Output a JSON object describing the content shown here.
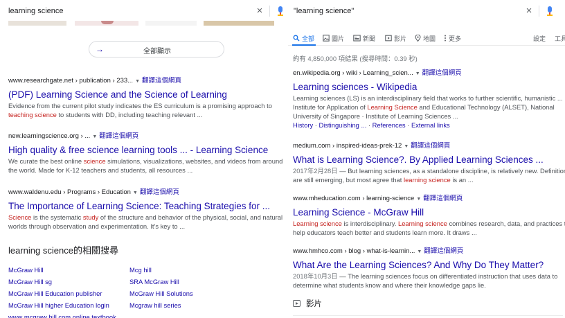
{
  "left": {
    "search": {
      "query": "learning science",
      "clear_glyph": "×"
    },
    "show_all": {
      "label": "全部顯示",
      "arrow": "→"
    },
    "translate_label": "翻譯這個網頁",
    "results": [
      {
        "domain": "www.researchgate.net",
        "path": " › publication › 233...",
        "title": "(PDF) Learning Science and the Science of Learning",
        "lines": [
          [
            {
              "t": "Evidence from the current pilot study indicates the ES curriculum is a promising approach to"
            }
          ],
          [
            {
              "t": "teaching science",
              "em": true
            },
            {
              "t": " to students with DD, including teaching relevant ..."
            }
          ]
        ]
      },
      {
        "domain": "new.learningscience.org",
        "path": " › ...",
        "title": "High quality & free science learning tools ... - Learning Science",
        "lines": [
          [
            {
              "t": "We curate the best online "
            },
            {
              "t": "science",
              "em": true
            },
            {
              "t": " simulations, visualizations, websites, and videos from around"
            }
          ],
          [
            {
              "t": "the world. Made for K-12 teachers and students, all resources ..."
            }
          ]
        ]
      },
      {
        "domain": "www.waldenu.edu",
        "path": " › Programs › Education",
        "title": "The Importance of Learning Science: Teaching Strategies for ...",
        "lines": [
          [
            {
              "t": "Science",
              "em": true
            },
            {
              "t": " is the systematic "
            },
            {
              "t": "study",
              "em": true
            },
            {
              "t": " of the structure and behavior of the physical, social, and natural"
            }
          ],
          [
            {
              "t": "worlds through observation and experimentation. It's key to ..."
            }
          ]
        ]
      }
    ],
    "related_heading": "learning science的相關搜尋",
    "related": [
      "McGraw Hill",
      "Mcg hill",
      "McGraw Hill sg",
      "SRA McGraw Hill",
      "McGraw Hill Education publisher",
      "McGraw Hill Solutions",
      "McGraw Hill higher Education login",
      "Mcgraw hill series",
      "www mcgraw hill com online textbook"
    ]
  },
  "right": {
    "search": {
      "query": "\"learning science\"",
      "clear_glyph": "×"
    },
    "tabs": [
      "全部",
      "圖片",
      "新聞",
      "影片",
      "地圖",
      "更多",
      "設定",
      "工具"
    ],
    "stats": "約有 4,850,000 項結果 (搜尋時間：0.39 秒)",
    "translate_label": "翻譯這個網頁",
    "results": [
      {
        "domain": "en.wikipedia.org",
        "path": " › wiki › Learning_scien...",
        "title": "Learning sciences - Wikipedia",
        "lines": [
          [
            {
              "t": "Learning sciences (LS) is an interdisciplinary field that works to further scientific, humanistic ..."
            }
          ],
          [
            {
              "t": "Institute for Application of "
            },
            {
              "t": "Learning Science",
              "em": true
            },
            {
              "t": " and Educational Technology (ALSET), National"
            }
          ],
          [
            {
              "t": "University of Singapore · Institute of Learning Sciences ..."
            }
          ]
        ],
        "links": [
          "History",
          "Distinguishing ...",
          "References",
          "External links"
        ]
      },
      {
        "domain": "medium.com",
        "path": " › inspired-ideas-prek-12",
        "title": "What is Learning Science?. By Applied Learning Sciences ...",
        "date": "2017年2月28日",
        "lines": [
          [
            {
              "t": " — But learning sciences, as a standalone discipline, is relatively new. Definitions",
              "dated": true
            }
          ],
          [
            {
              "t": "are still emerging, but most agree that "
            },
            {
              "t": "learning science",
              "em": true
            },
            {
              "t": " is an ..."
            }
          ]
        ]
      },
      {
        "domain": "www.mheducation.com",
        "path": " › learning-science",
        "title": "Learning Science - McGraw Hill",
        "lines": [
          [
            {
              "t": "Learning science",
              "em": true
            },
            {
              "t": " is interdisciplinary. "
            },
            {
              "t": "Learning science",
              "em": true
            },
            {
              "t": " combines research, data, and practices to"
            }
          ],
          [
            {
              "t": "help educators teach better and students learn more. It draws ..."
            }
          ]
        ]
      },
      {
        "domain": "www.hmhco.com",
        "path": " › blog › what-is-learnin...",
        "title": "What Are the Learning Sciences? And Why Do They Matter?",
        "date": "2018年10月3日",
        "lines": [
          [
            {
              "t": " — The learning sciences focus on differentiated instruction that uses data to",
              "dated": true
            }
          ],
          [
            {
              "t": "determine what students know and where their knowledge gaps lie."
            }
          ]
        ]
      }
    ],
    "video_heading": "影片"
  },
  "colors": {
    "link": "#1a0dab",
    "emphasis": "#c5221f",
    "accent": "#1a73e8",
    "snippet": "#4d5156"
  },
  "icons": [
    "search-icon",
    "image-icon",
    "news-icon",
    "video-icon",
    "map-pin-icon",
    "more-dots-icon",
    "mic-icon",
    "clear-icon",
    "arrow-right-icon"
  ]
}
